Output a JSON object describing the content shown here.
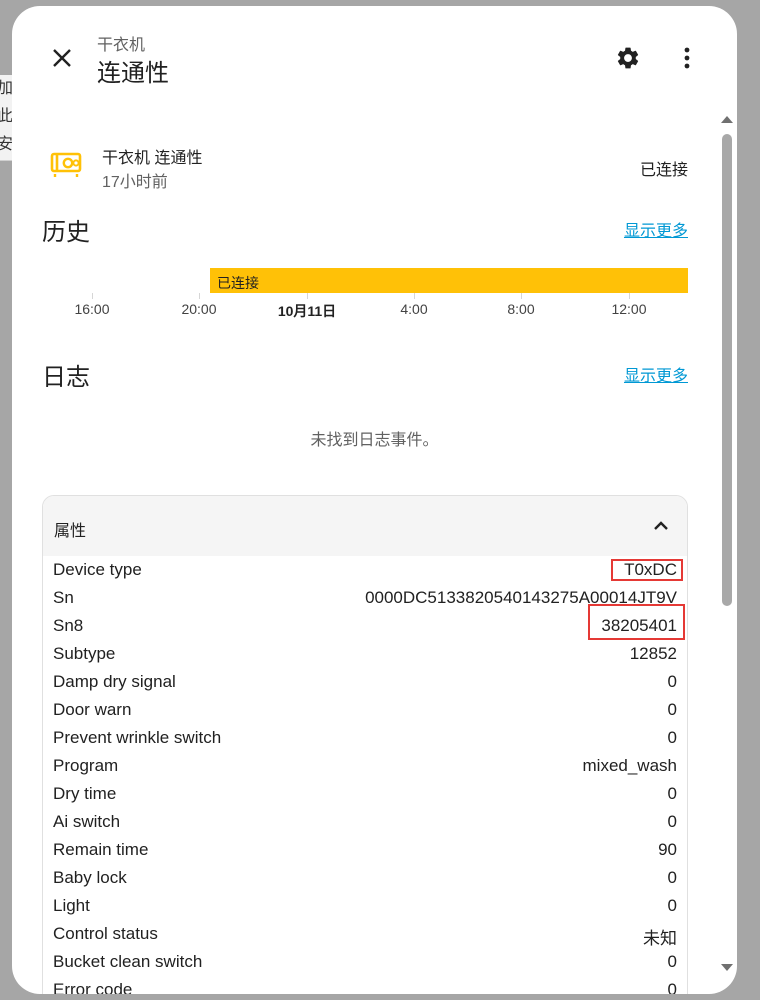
{
  "background": {
    "lines": [
      "加此",
      "安装"
    ]
  },
  "header": {
    "subtitle": "干衣机",
    "title": "连通性"
  },
  "entity": {
    "name": "干衣机 连通性",
    "last_changed": "17小时前",
    "state": "已连接",
    "icon": "dryer-icon",
    "icon_color": "#ffc107"
  },
  "history": {
    "title": "历史",
    "show_more": "显示更多",
    "bar_label": "已连接",
    "bar_color": "#ffc107",
    "ticks": [
      "16:00",
      "20:00",
      "10月11日",
      "4:00",
      "8:00",
      "12:00"
    ]
  },
  "logbook": {
    "title": "日志",
    "show_more": "显示更多",
    "empty_text": "未找到日志事件。"
  },
  "attributes": {
    "title": "属性",
    "rows": [
      {
        "key": "Device type",
        "value": "T0xDC"
      },
      {
        "key": "Sn",
        "value": "0000DC5133820540143275A00014JT9V"
      },
      {
        "key": "Sn8",
        "value": "38205401"
      },
      {
        "key": "Subtype",
        "value": "12852"
      },
      {
        "key": "Damp dry signal",
        "value": "0"
      },
      {
        "key": "Door warn",
        "value": "0"
      },
      {
        "key": "Prevent wrinkle switch",
        "value": "0"
      },
      {
        "key": "Program",
        "value": "mixed_wash"
      },
      {
        "key": "Dry time",
        "value": "0"
      },
      {
        "key": "Ai switch",
        "value": "0"
      },
      {
        "key": "Remain time",
        "value": "90"
      },
      {
        "key": "Baby lock",
        "value": "0"
      },
      {
        "key": "Light",
        "value": "0"
      },
      {
        "key": "Control status",
        "value": "未知"
      },
      {
        "key": "Bucket clean switch",
        "value": "0"
      },
      {
        "key": "Error code",
        "value": "0"
      }
    ]
  },
  "highlight_color": "#e53935"
}
